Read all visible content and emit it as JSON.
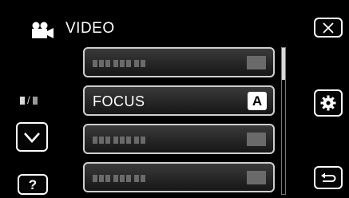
{
  "header": {
    "title": "VIDEO",
    "icon": "video-camera-icon"
  },
  "buttons": {
    "close_icon": "close-icon",
    "settings_icon": "gear-icon",
    "back_icon": "return-arrow-icon",
    "down_icon": "chevron-down-icon",
    "help_label": "?"
  },
  "page_indicator": {
    "icon": "page-indicator-icon"
  },
  "menu": {
    "items": [
      {
        "label": "",
        "value": ""
      },
      {
        "label": "FOCUS",
        "value": "A"
      },
      {
        "label": "",
        "value": ""
      },
      {
        "label": "",
        "value": ""
      }
    ],
    "selected_index": 1
  },
  "colors": {
    "background": "#000000",
    "frame": "#ffffff",
    "item_border": "#cfcfcf"
  }
}
